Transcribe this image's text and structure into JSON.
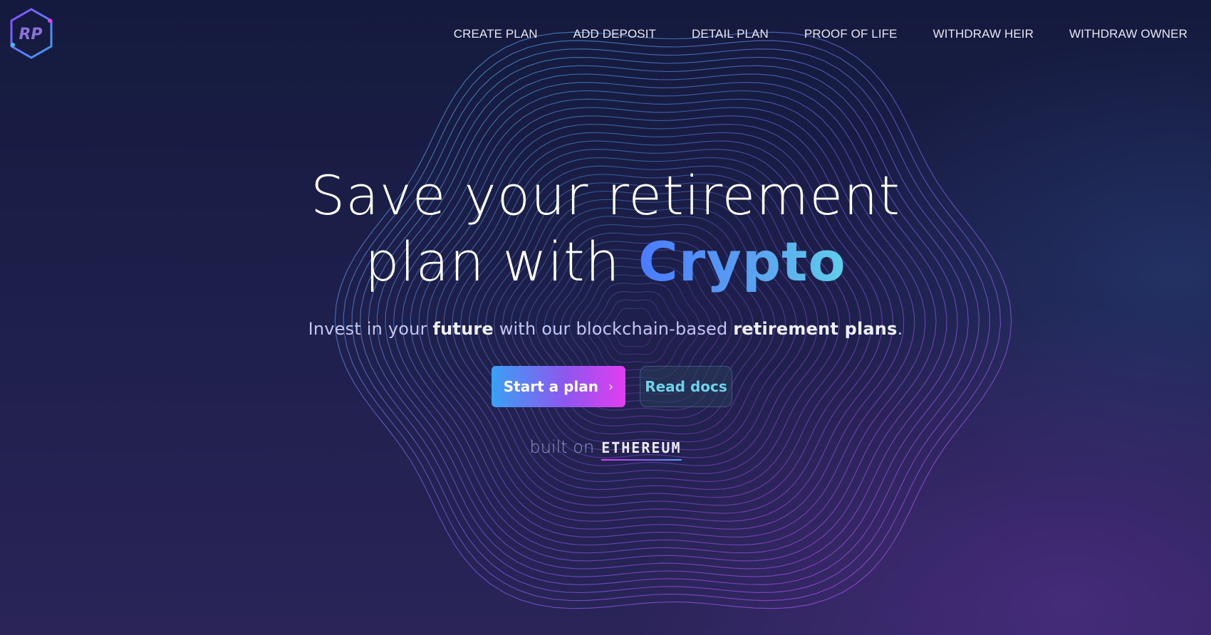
{
  "brand": {
    "logo_text": "RP",
    "colors": {
      "accent_blue": "#4a7bff",
      "accent_cyan": "#5fd0ea",
      "accent_magenta": "#e13df0"
    }
  },
  "nav": {
    "items": [
      {
        "label": "CREATE PLAN"
      },
      {
        "label": "ADD DEPOSIT"
      },
      {
        "label": "DETAIL PLAN"
      },
      {
        "label": "PROOF OF LIFE"
      },
      {
        "label": "WITHDRAW HEIR"
      },
      {
        "label": "WITHDRAW OWNER"
      }
    ]
  },
  "hero": {
    "headline_line1": "Save your retirement",
    "headline_line2_prefix": "plan with ",
    "headline_accent": "Crypto",
    "subtitle": {
      "part1": "Invest in your ",
      "bold1": "future",
      "part2": " with our blockchain-based ",
      "bold2": "retirement plans",
      "part3": "."
    },
    "primary_button": {
      "label": "Start a plan",
      "icon": "chevron-right-icon"
    },
    "secondary_button": {
      "label": "Read docs"
    },
    "built_on": {
      "lead": "built on",
      "chain": "ETHEREUM"
    }
  }
}
